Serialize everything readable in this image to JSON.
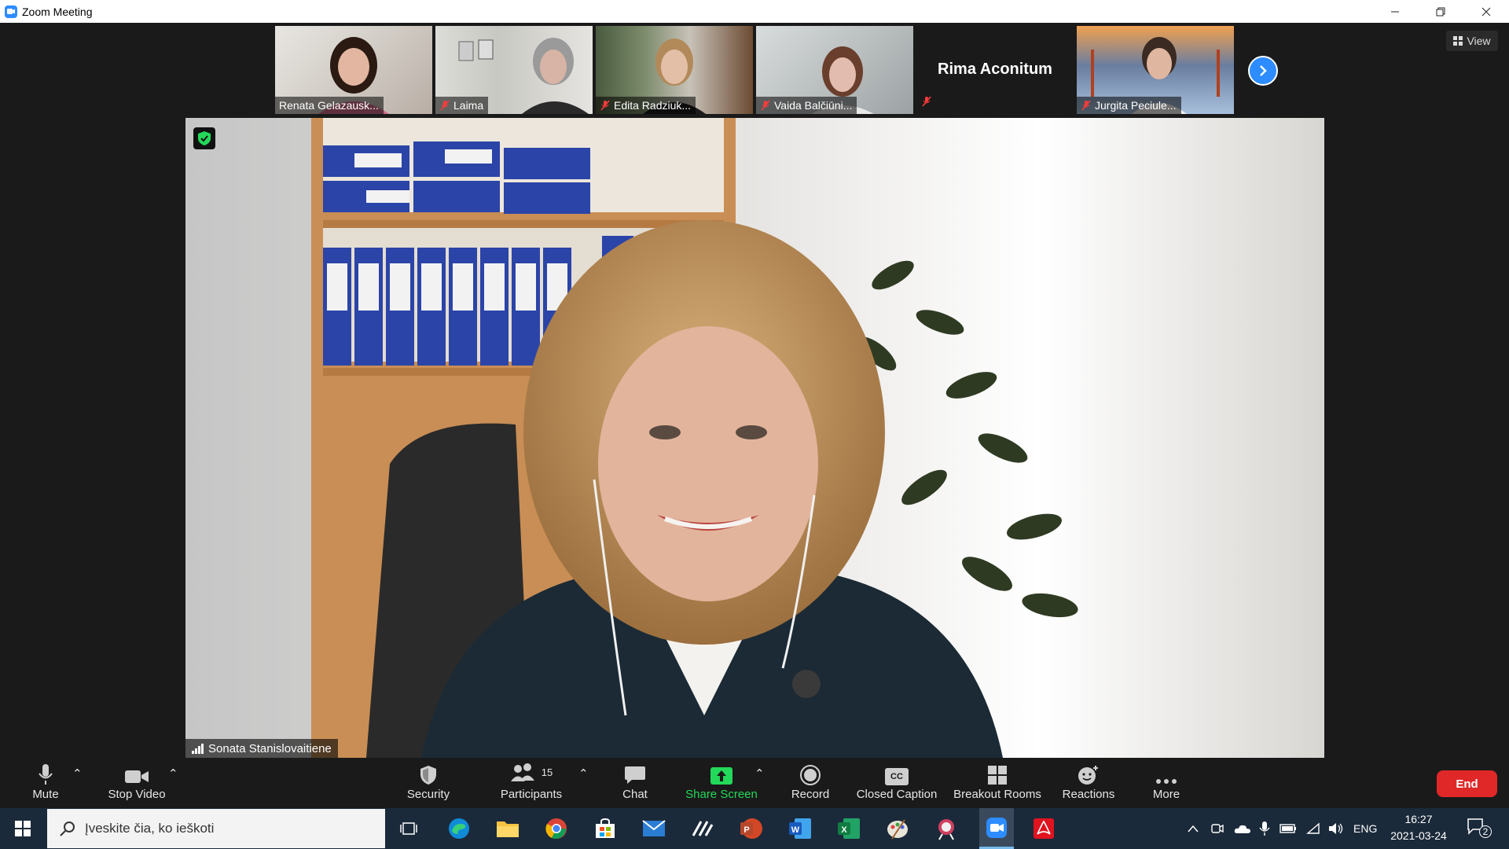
{
  "window": {
    "title": "Zoom Meeting"
  },
  "gallery": {
    "thumbs": [
      {
        "name": "Renata Gelazausk..."
      },
      {
        "name": "Laima"
      },
      {
        "name": "Edita Radziuk..."
      },
      {
        "name": "Vaida Balčiūni..."
      },
      {
        "name": "Rima Aconitum"
      },
      {
        "name": "Jurgita Peciule..."
      }
    ],
    "view_label": "View"
  },
  "speaker": {
    "name": "Sonata Stanislovaitiene"
  },
  "toolbar": {
    "mute": "Mute",
    "stop_video": "Stop Video",
    "security": "Security",
    "participants": "Participants",
    "participants_count": "15",
    "chat": "Chat",
    "share_screen": "Share Screen",
    "record": "Record",
    "closed_caption": "Closed Caption",
    "cc_badge": "CC",
    "breakout_rooms": "Breakout Rooms",
    "reactions": "Reactions",
    "more": "More",
    "end": "End"
  },
  "taskbar": {
    "search_placeholder": "Įveskite čia, ko ieškoti",
    "lang": "ENG",
    "time": "16:27",
    "date": "2021-03-24",
    "notifications": "2"
  },
  "colors": {
    "accent": "#2d8cff",
    "share_green": "#23d959",
    "end_red": "#e02828"
  }
}
